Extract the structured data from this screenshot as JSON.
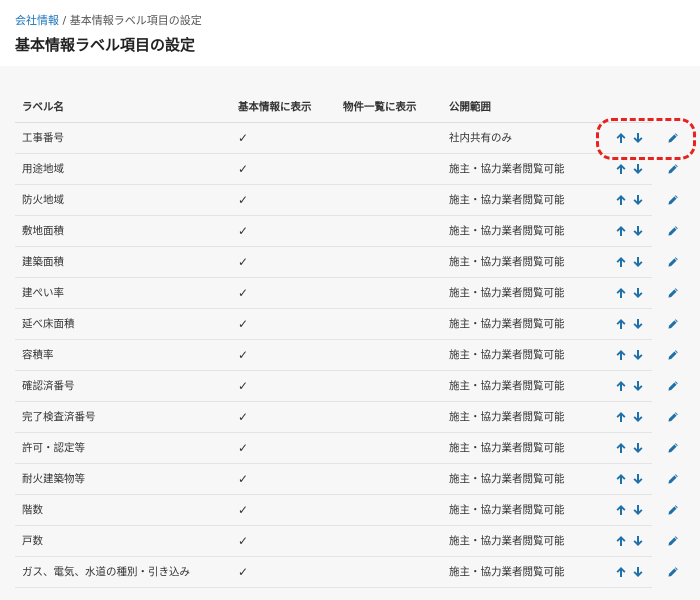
{
  "breadcrumb": {
    "parent": "会社情報",
    "separator": " / ",
    "current": "基本情報ラベル項目の設定"
  },
  "page_title": "基本情報ラベル項目の設定",
  "columns": {
    "label": "ラベル名",
    "basic": "基本情報に表示",
    "list": "物件一覧に表示",
    "scope": "公開範囲"
  },
  "check_mark": "✓",
  "rows": [
    {
      "label": "工事番号",
      "scope": "社内共有のみ"
    },
    {
      "label": "用途地域",
      "scope": "施主・協力業者閲覧可能"
    },
    {
      "label": "防火地域",
      "scope": "施主・協力業者閲覧可能"
    },
    {
      "label": "敷地面積",
      "scope": "施主・協力業者閲覧可能"
    },
    {
      "label": "建築面積",
      "scope": "施主・協力業者閲覧可能"
    },
    {
      "label": "建ぺい率",
      "scope": "施主・協力業者閲覧可能"
    },
    {
      "label": "延べ床面積",
      "scope": "施主・協力業者閲覧可能"
    },
    {
      "label": "容積率",
      "scope": "施主・協力業者閲覧可能"
    },
    {
      "label": "確認済番号",
      "scope": "施主・協力業者閲覧可能"
    },
    {
      "label": "完了検査済番号",
      "scope": "施主・協力業者閲覧可能"
    },
    {
      "label": "許可・認定等",
      "scope": "施主・協力業者閲覧可能"
    },
    {
      "label": "耐火建築物等",
      "scope": "施主・協力業者閲覧可能"
    },
    {
      "label": "階数",
      "scope": "施主・協力業者閲覧可能"
    },
    {
      "label": "戸数",
      "scope": "施主・協力業者閲覧可能"
    },
    {
      "label": "ガス、電気、水道の種別・引き込み",
      "scope": "施主・協力業者閲覧可能"
    }
  ],
  "icons": {
    "up": "arrow-up-icon",
    "down": "arrow-down-icon",
    "edit": "pencil-icon"
  },
  "colors": {
    "link": "#1a73b8",
    "icon": "#1f6fa8",
    "callout": "#e6231e"
  }
}
